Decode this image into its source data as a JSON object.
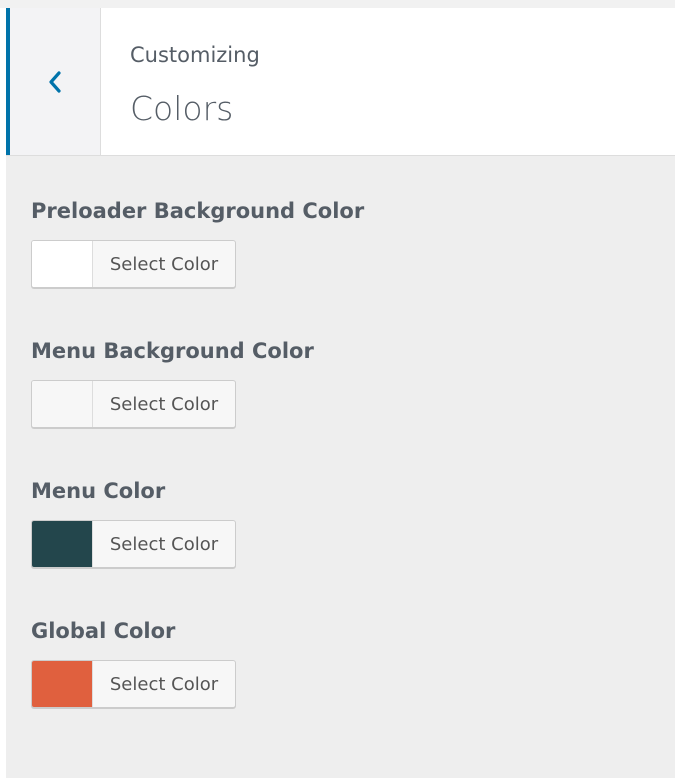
{
  "header": {
    "context": "Customizing",
    "section_title": "Colors"
  },
  "controls": [
    {
      "label": "Preloader Background Color",
      "button_label": "Select Color",
      "swatch_color": "#ffffff"
    },
    {
      "label": "Menu Background Color",
      "button_label": "Select Color",
      "swatch_color": "#f7f7f7"
    },
    {
      "label": "Menu Color",
      "button_label": "Select Color",
      "swatch_color": "#23464c"
    },
    {
      "label": "Global Color",
      "button_label": "Select Color",
      "swatch_color": "#e0603e"
    }
  ],
  "colors": {
    "accent": "#0073aa"
  },
  "icons": {
    "back": "chevron-left-icon"
  }
}
